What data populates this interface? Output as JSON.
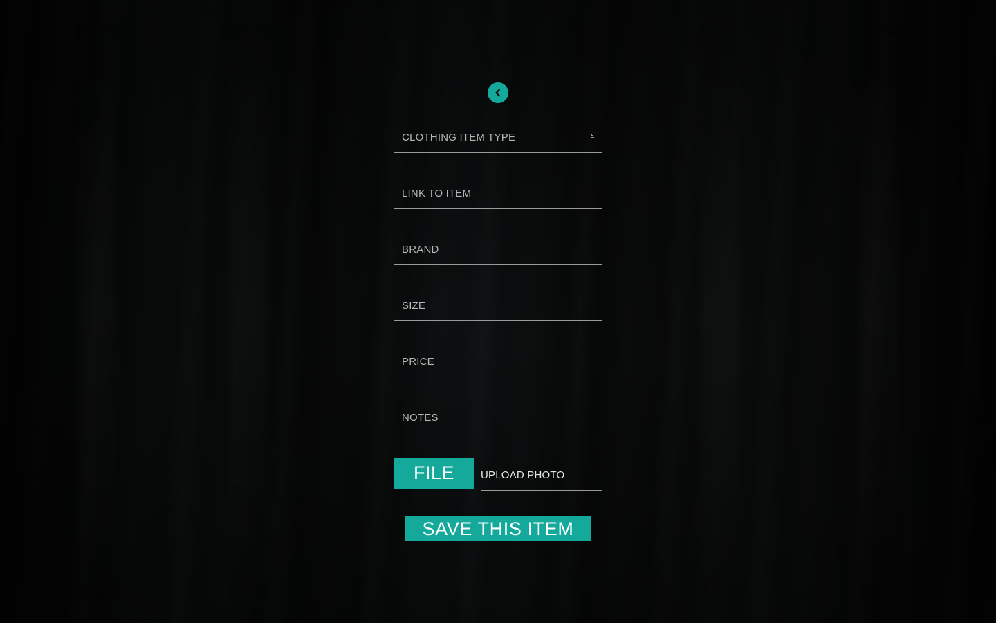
{
  "colors": {
    "accent": "#14a99b",
    "background": "#050505",
    "field_underline": "#9a9a9a",
    "placeholder_text": "#b5b5b5",
    "button_text": "#ffffff"
  },
  "header": {
    "back_icon": "chevron-left-icon"
  },
  "form": {
    "fields": [
      {
        "id": "clothing-item-type",
        "placeholder": "CLOTHING ITEM TYPE",
        "value": "",
        "icon": "dropdown-picker-icon"
      },
      {
        "id": "link-to-item",
        "placeholder": "LINK TO ITEM",
        "value": ""
      },
      {
        "id": "brand",
        "placeholder": "BRAND",
        "value": ""
      },
      {
        "id": "size",
        "placeholder": "SIZE",
        "value": ""
      },
      {
        "id": "price",
        "placeholder": "PRICE",
        "value": ""
      },
      {
        "id": "notes",
        "placeholder": "NOTES",
        "value": ""
      }
    ],
    "file_button_label": "FILE",
    "upload_label": "UPLOAD PHOTO",
    "save_button_label": "SAVE THIS ITEM"
  }
}
